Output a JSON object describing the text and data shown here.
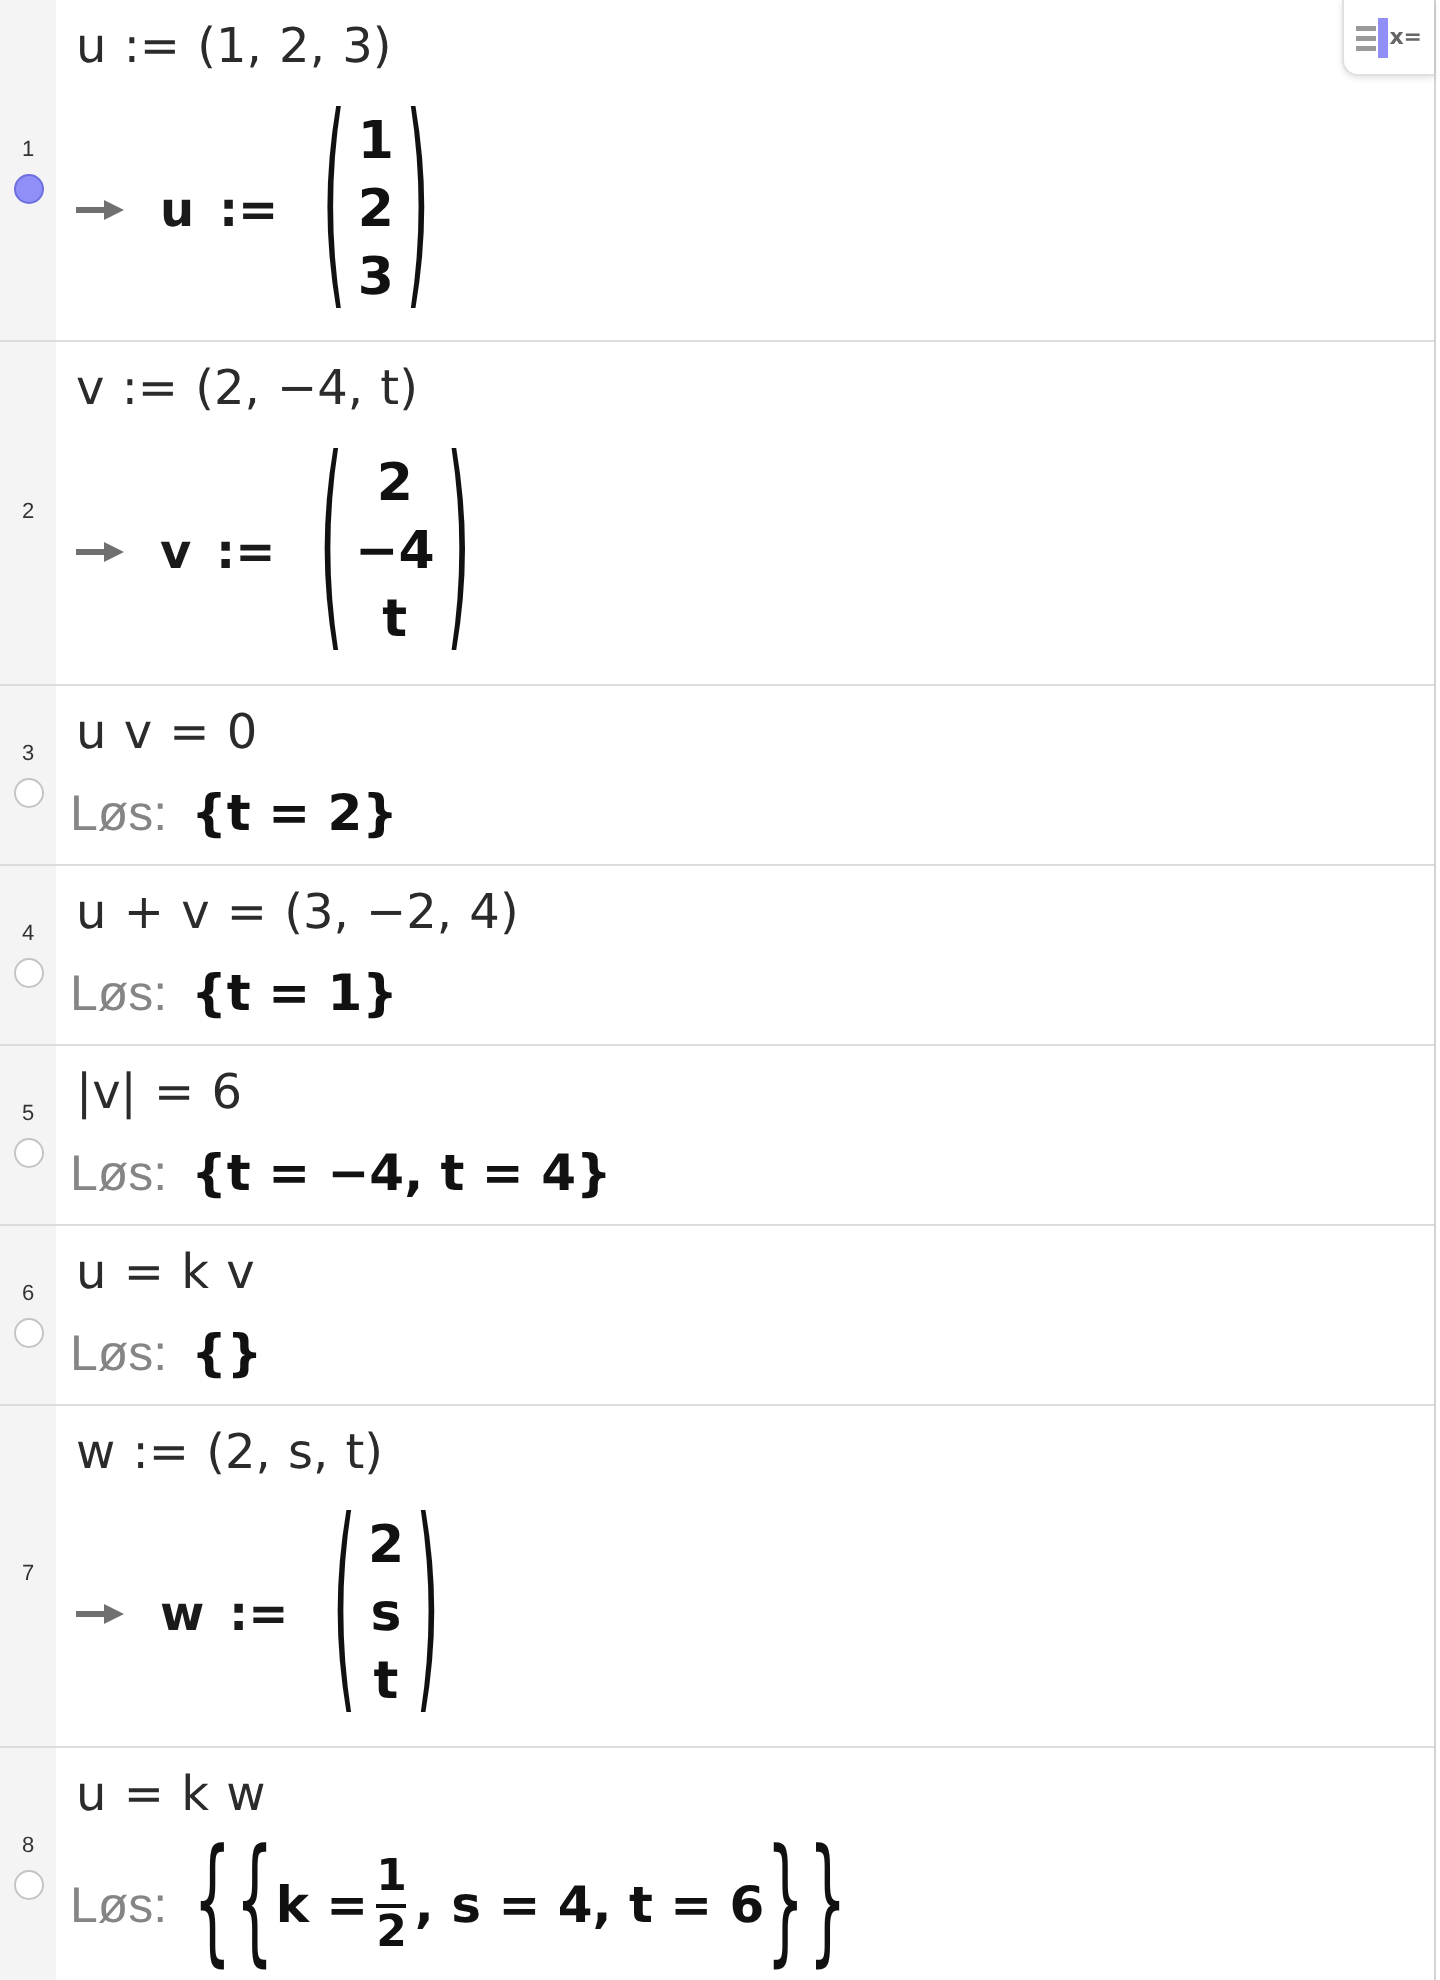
{
  "view_button": {
    "label": "x="
  },
  "rows": [
    {
      "number": "1",
      "visible": true,
      "input": "u := (1, 2, 3)",
      "output": {
        "kind": "vector",
        "label": "u :=",
        "open": "(",
        "entries": [
          "1",
          "2",
          "3"
        ],
        "close": ")"
      }
    },
    {
      "number": "2",
      "input": "v := (2, −4, t)",
      "output": {
        "kind": "vector",
        "label": "v :=",
        "open": "(",
        "entries": [
          "2",
          "−4",
          "t"
        ],
        "close": ")"
      }
    },
    {
      "number": "3",
      "visible": false,
      "input": "u v = 0",
      "output": {
        "kind": "solve",
        "label": "Løs:",
        "result": [
          {
            "kind": "text",
            "text": "{t = 2}"
          }
        ]
      }
    },
    {
      "number": "4",
      "visible": false,
      "input": "u + v = (3, −2, 4)",
      "output": {
        "kind": "solve",
        "label": "Løs:",
        "result": [
          {
            "kind": "text",
            "text": "{t = 1}"
          }
        ]
      }
    },
    {
      "number": "5",
      "visible": false,
      "input": "|v| = 6",
      "output": {
        "kind": "solve",
        "label": "Løs:",
        "result": [
          {
            "kind": "text",
            "text": "{t = −4, t = 4}"
          }
        ]
      }
    },
    {
      "number": "6",
      "visible": false,
      "input": "u = k v",
      "output": {
        "kind": "solve",
        "label": "Løs:",
        "result": [
          {
            "kind": "text",
            "text": "{}"
          }
        ]
      }
    },
    {
      "number": "7",
      "input": "w := (2, s, t)",
      "output": {
        "kind": "vector",
        "label": "w :=",
        "open": "(",
        "entries": [
          "2",
          "s",
          "t"
        ],
        "close": ")"
      }
    },
    {
      "number": "8",
      "visible": false,
      "input": "u = k w",
      "output": {
        "kind": "solve",
        "label": "Løs:",
        "result": [
          {
            "kind": "delimiter",
            "text": "{"
          },
          {
            "kind": "delimiter",
            "text": "{"
          },
          {
            "kind": "text",
            "text": "k ="
          },
          {
            "kind": "fraction",
            "numerator": "1",
            "denominator": "2"
          },
          {
            "kind": "text",
            "text": ", s = 4, t = 6"
          },
          {
            "kind": "delimiter",
            "text": "}"
          },
          {
            "kind": "delimiter",
            "text": "}"
          }
        ]
      }
    }
  ]
}
